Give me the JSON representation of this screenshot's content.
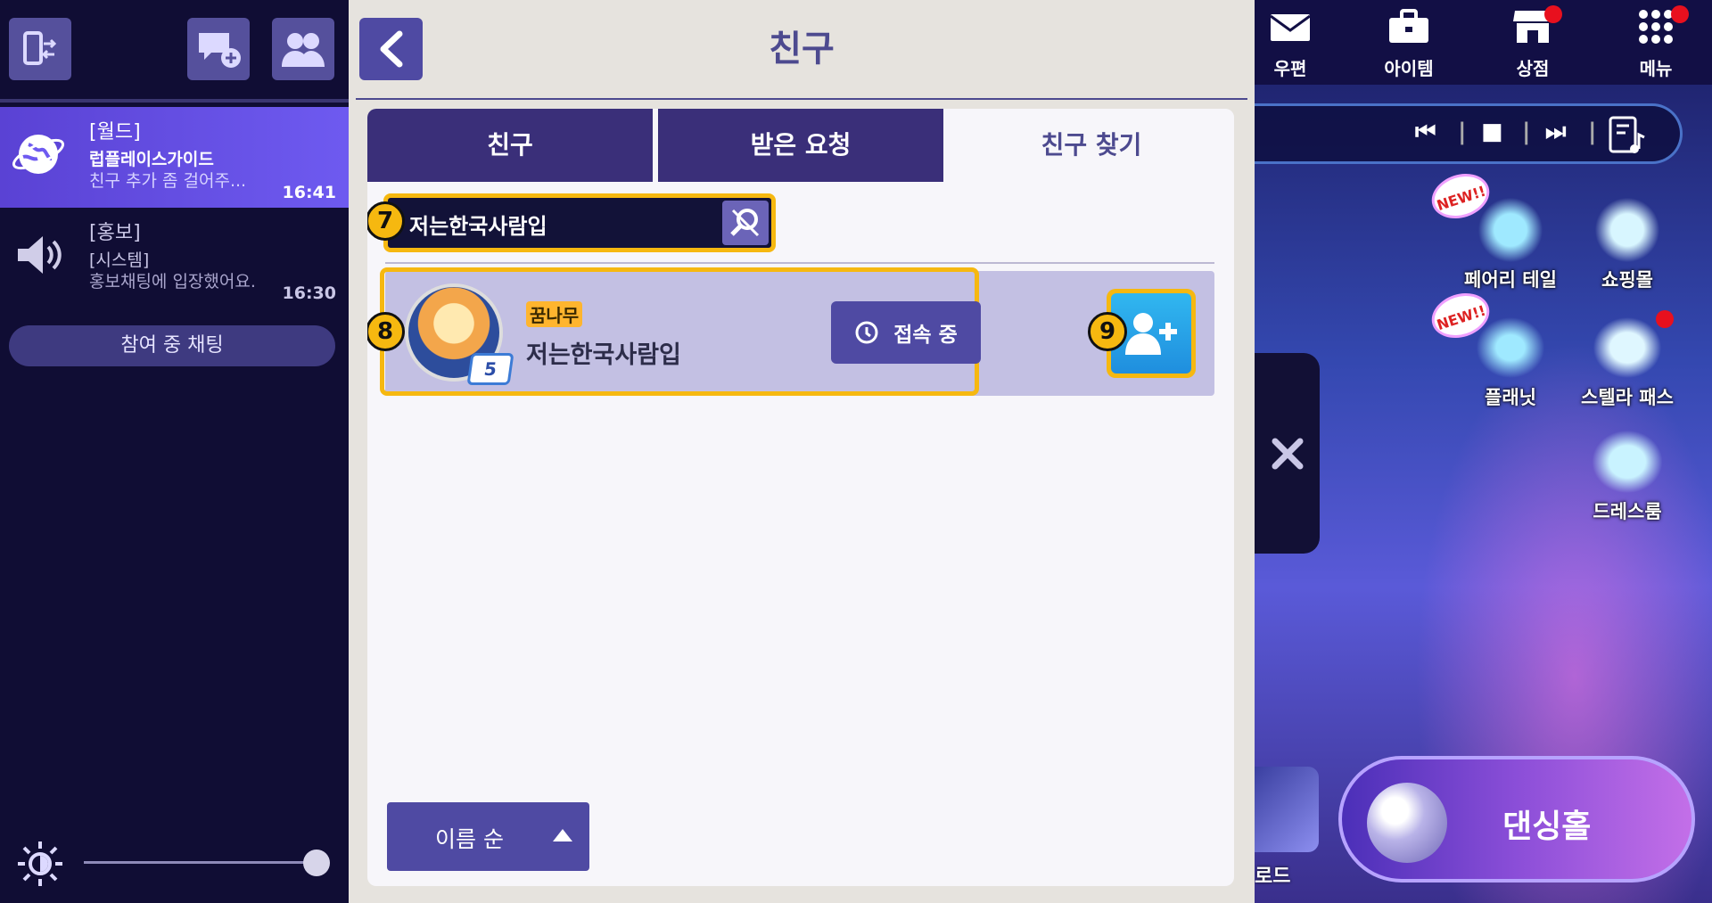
{
  "left_panel": {
    "chats": [
      {
        "channel": "[월드]",
        "sender": "럽플레이스가이드",
        "message": "친구 추가 좀 걸어주...",
        "time": "16:41"
      },
      {
        "channel": "[홍보]",
        "sender": "[시스템]",
        "message": "홍보채팅에 입장했어요.",
        "time": "16:30"
      }
    ],
    "joined_chat_label": "참여 중 채팅",
    "brightness": 1.0
  },
  "friend_panel": {
    "title": "친구",
    "tabs": [
      {
        "label": "친구",
        "selected": false
      },
      {
        "label": "받은 요청",
        "selected": false
      },
      {
        "label": "친구 찾기",
        "selected": true
      }
    ],
    "search": {
      "value": "저는한국사람입",
      "marker": "7"
    },
    "result": {
      "marker": "8",
      "tag": "꿈나무",
      "name": "저는한국사람입",
      "level": "5",
      "status": "접속 중",
      "add_marker": "9"
    },
    "sort": {
      "label": "이름 순"
    }
  },
  "top_menu": [
    {
      "label": "우편",
      "icon": "mail-icon",
      "badge": false
    },
    {
      "label": "아이템",
      "icon": "briefcase-icon",
      "badge": false
    },
    {
      "label": "상점",
      "icon": "shop-icon",
      "badge": true
    },
    {
      "label": "메뉴",
      "icon": "grid-menu-icon",
      "badge": true
    }
  ],
  "game_icons": [
    {
      "label": "페어리 테일",
      "new": true,
      "badge": false
    },
    {
      "label": "쇼핑몰",
      "new": false,
      "badge": false
    },
    {
      "label": "플래닛",
      "new": true,
      "badge": false
    },
    {
      "label": "스텔라 패스",
      "new": false,
      "badge": true
    },
    {
      "label": "드레스룸",
      "new": false,
      "badge": false
    }
  ],
  "new_badge_text": "NEW!!",
  "road_label": "로드",
  "dance_hall_label": "댄싱홀",
  "colors": {
    "accent": "#4f4aa3",
    "highlight": "#f6b810",
    "add_button": "#1f8ede",
    "chat_active": "#6e5af0"
  }
}
